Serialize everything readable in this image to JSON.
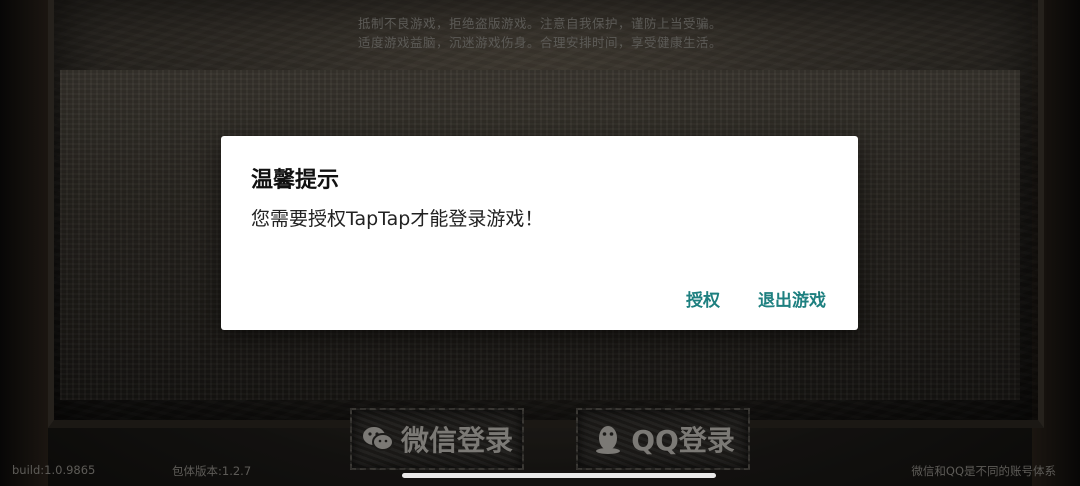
{
  "notice": {
    "line1": "抵制不良游戏，拒绝盗版游戏。注意自我保护，谨防上当受骗。",
    "line2": "适度游戏益脑，沉迷游戏伤身。合理安排时间，享受健康生活。"
  },
  "dialog": {
    "title": "温馨提示",
    "message": "您需要授权TapTap才能登录游戏！",
    "authorize_label": "授权",
    "exit_label": "退出游戏",
    "accent": "#1e8080"
  },
  "login": {
    "wechat_label": "微信登录",
    "qq_label": "QQ登录"
  },
  "footer": {
    "build": "build:1.0.9865",
    "package_version": "包体版本:1.2.7",
    "account_note": "微信和QQ是不同的账号体系"
  }
}
